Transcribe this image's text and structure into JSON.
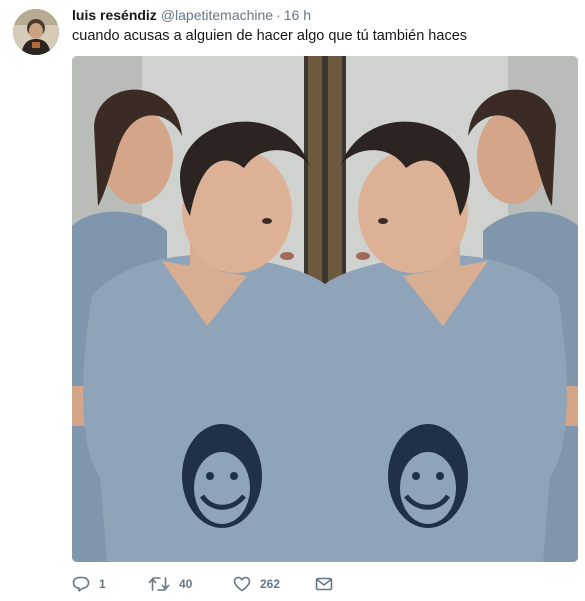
{
  "tweet": {
    "author_name": "luis reséndiz",
    "author_handle": "@lapetitemachine",
    "separator": "·",
    "time": "16 h",
    "text": "cuando acusas a alguien de hacer algo que tú también haces",
    "avatar_icon": "user-avatar",
    "media_description": "mirrored photo of a boy in a grey v-neck t-shirt facing his own reflection"
  },
  "actions": {
    "reply_count": "1",
    "retweet_count": "40",
    "like_count": "262",
    "reply_icon": "reply-icon",
    "retweet_icon": "retweet-icon",
    "like_icon": "heart-icon",
    "dm_icon": "envelope-icon"
  },
  "colors": {
    "text_primary": "#14171a",
    "text_secondary": "#657786",
    "shirt": "#8fa4b8"
  }
}
